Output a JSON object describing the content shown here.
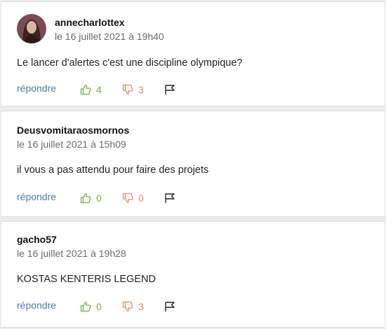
{
  "comments": [
    {
      "author": "annecharlottex",
      "date": "le 16 juillet 2021 à 19h40",
      "text": "Le lancer d'alertes c'est une discipline olympique?",
      "reply_label": "répondre",
      "likes": "4",
      "dislikes": "3"
    },
    {
      "author": "Deusvomitaraosmornos",
      "date": "le 16 juillet 2021 à 15h09",
      "text": "il vous a pas attendu pour faire des projets",
      "reply_label": "répondre",
      "likes": "0",
      "dislikes": "0"
    },
    {
      "author": "gacho57",
      "date": "le 16 juillet 2021 à 19h28",
      "text": "KOSTAS KENTERIS LEGEND",
      "reply_label": "répondre",
      "likes": "0",
      "dislikes": "3"
    }
  ],
  "colors": {
    "reply": "#4a7cab",
    "like": "#6db33f",
    "dislike": "#e58a65",
    "background": "#ececec"
  },
  "icons": {
    "like": "thumbs-up-icon",
    "dislike": "thumbs-down-icon",
    "flag": "flag-icon"
  }
}
